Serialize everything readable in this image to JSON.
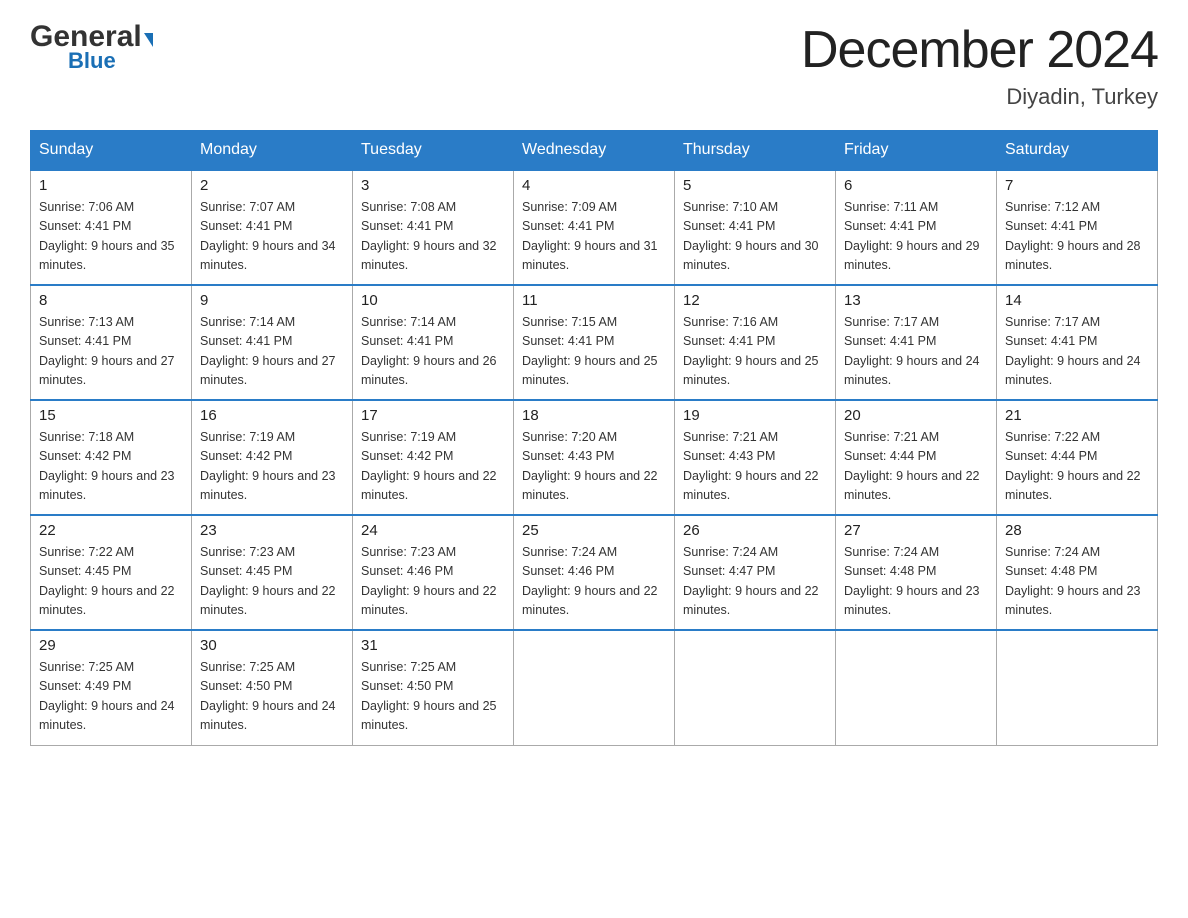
{
  "header": {
    "logo_general": "General",
    "logo_blue": "Blue",
    "month_title": "December 2024",
    "location": "Diyadin, Turkey"
  },
  "days_of_week": [
    "Sunday",
    "Monday",
    "Tuesday",
    "Wednesday",
    "Thursday",
    "Friday",
    "Saturday"
  ],
  "weeks": [
    [
      {
        "date": "1",
        "sunrise": "7:06 AM",
        "sunset": "4:41 PM",
        "daylight": "9 hours and 35 minutes."
      },
      {
        "date": "2",
        "sunrise": "7:07 AM",
        "sunset": "4:41 PM",
        "daylight": "9 hours and 34 minutes."
      },
      {
        "date": "3",
        "sunrise": "7:08 AM",
        "sunset": "4:41 PM",
        "daylight": "9 hours and 32 minutes."
      },
      {
        "date": "4",
        "sunrise": "7:09 AM",
        "sunset": "4:41 PM",
        "daylight": "9 hours and 31 minutes."
      },
      {
        "date": "5",
        "sunrise": "7:10 AM",
        "sunset": "4:41 PM",
        "daylight": "9 hours and 30 minutes."
      },
      {
        "date": "6",
        "sunrise": "7:11 AM",
        "sunset": "4:41 PM",
        "daylight": "9 hours and 29 minutes."
      },
      {
        "date": "7",
        "sunrise": "7:12 AM",
        "sunset": "4:41 PM",
        "daylight": "9 hours and 28 minutes."
      }
    ],
    [
      {
        "date": "8",
        "sunrise": "7:13 AM",
        "sunset": "4:41 PM",
        "daylight": "9 hours and 27 minutes."
      },
      {
        "date": "9",
        "sunrise": "7:14 AM",
        "sunset": "4:41 PM",
        "daylight": "9 hours and 27 minutes."
      },
      {
        "date": "10",
        "sunrise": "7:14 AM",
        "sunset": "4:41 PM",
        "daylight": "9 hours and 26 minutes."
      },
      {
        "date": "11",
        "sunrise": "7:15 AM",
        "sunset": "4:41 PM",
        "daylight": "9 hours and 25 minutes."
      },
      {
        "date": "12",
        "sunrise": "7:16 AM",
        "sunset": "4:41 PM",
        "daylight": "9 hours and 25 minutes."
      },
      {
        "date": "13",
        "sunrise": "7:17 AM",
        "sunset": "4:41 PM",
        "daylight": "9 hours and 24 minutes."
      },
      {
        "date": "14",
        "sunrise": "7:17 AM",
        "sunset": "4:41 PM",
        "daylight": "9 hours and 24 minutes."
      }
    ],
    [
      {
        "date": "15",
        "sunrise": "7:18 AM",
        "sunset": "4:42 PM",
        "daylight": "9 hours and 23 minutes."
      },
      {
        "date": "16",
        "sunrise": "7:19 AM",
        "sunset": "4:42 PM",
        "daylight": "9 hours and 23 minutes."
      },
      {
        "date": "17",
        "sunrise": "7:19 AM",
        "sunset": "4:42 PM",
        "daylight": "9 hours and 22 minutes."
      },
      {
        "date": "18",
        "sunrise": "7:20 AM",
        "sunset": "4:43 PM",
        "daylight": "9 hours and 22 minutes."
      },
      {
        "date": "19",
        "sunrise": "7:21 AM",
        "sunset": "4:43 PM",
        "daylight": "9 hours and 22 minutes."
      },
      {
        "date": "20",
        "sunrise": "7:21 AM",
        "sunset": "4:44 PM",
        "daylight": "9 hours and 22 minutes."
      },
      {
        "date": "21",
        "sunrise": "7:22 AM",
        "sunset": "4:44 PM",
        "daylight": "9 hours and 22 minutes."
      }
    ],
    [
      {
        "date": "22",
        "sunrise": "7:22 AM",
        "sunset": "4:45 PM",
        "daylight": "9 hours and 22 minutes."
      },
      {
        "date": "23",
        "sunrise": "7:23 AM",
        "sunset": "4:45 PM",
        "daylight": "9 hours and 22 minutes."
      },
      {
        "date": "24",
        "sunrise": "7:23 AM",
        "sunset": "4:46 PM",
        "daylight": "9 hours and 22 minutes."
      },
      {
        "date": "25",
        "sunrise": "7:24 AM",
        "sunset": "4:46 PM",
        "daylight": "9 hours and 22 minutes."
      },
      {
        "date": "26",
        "sunrise": "7:24 AM",
        "sunset": "4:47 PM",
        "daylight": "9 hours and 22 minutes."
      },
      {
        "date": "27",
        "sunrise": "7:24 AM",
        "sunset": "4:48 PM",
        "daylight": "9 hours and 23 minutes."
      },
      {
        "date": "28",
        "sunrise": "7:24 AM",
        "sunset": "4:48 PM",
        "daylight": "9 hours and 23 minutes."
      }
    ],
    [
      {
        "date": "29",
        "sunrise": "7:25 AM",
        "sunset": "4:49 PM",
        "daylight": "9 hours and 24 minutes."
      },
      {
        "date": "30",
        "sunrise": "7:25 AM",
        "sunset": "4:50 PM",
        "daylight": "9 hours and 24 minutes."
      },
      {
        "date": "31",
        "sunrise": "7:25 AM",
        "sunset": "4:50 PM",
        "daylight": "9 hours and 25 minutes."
      },
      null,
      null,
      null,
      null
    ]
  ]
}
